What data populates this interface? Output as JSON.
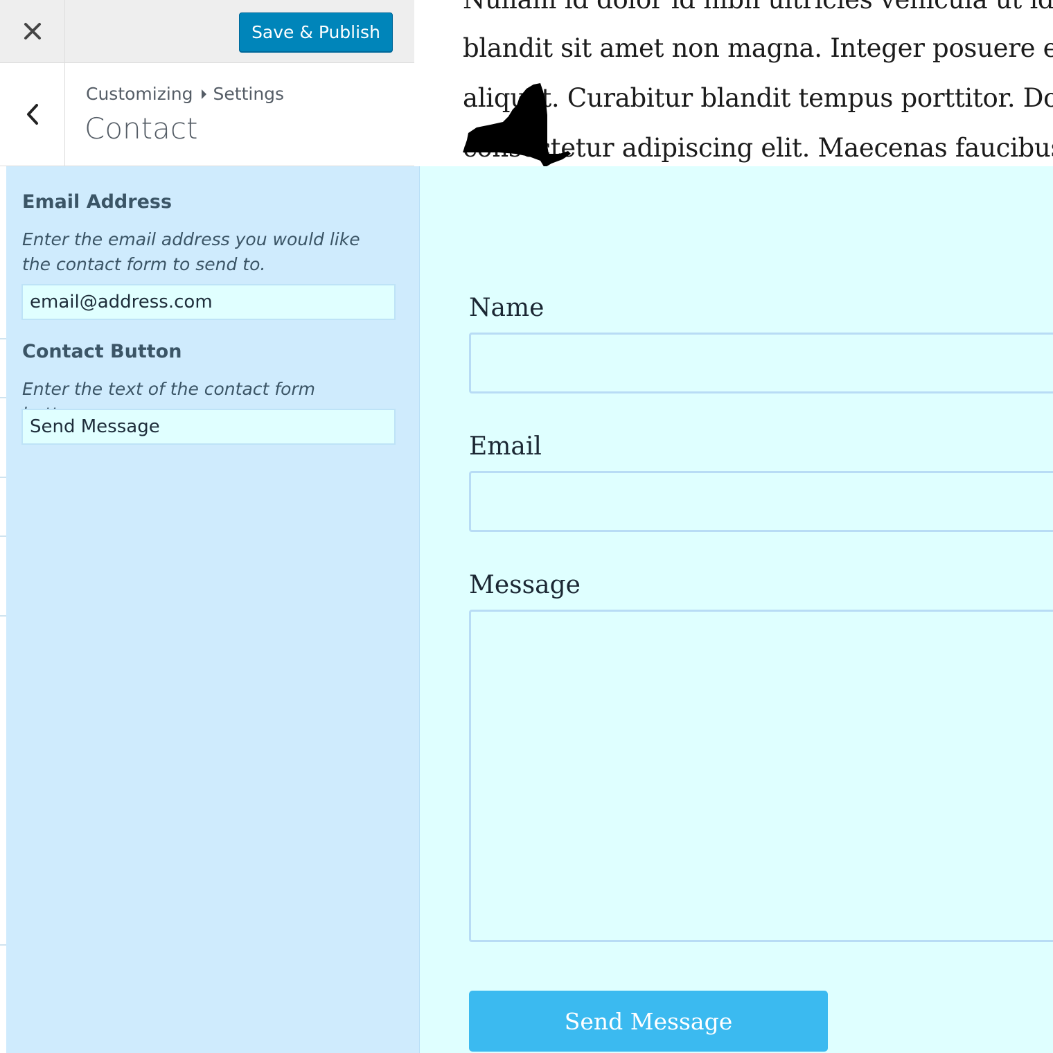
{
  "header": {
    "close_label": "close",
    "publish_label": "Save & Publish",
    "back_label": "back"
  },
  "section": {
    "breadcrumb": [
      "Customizing",
      "Settings"
    ],
    "title": "Contact"
  },
  "controls": {
    "email": {
      "label": "Email Address",
      "description": "Enter the email address you would like the contact form to send to.",
      "value": "email@address.com"
    },
    "button": {
      "label": "Contact Button",
      "description": "Enter the text of the contact form button.",
      "value": "Send Message"
    }
  },
  "preview": {
    "paragraph_lines": [
      "Nullam id dolor id nibh ultricies vehicula ut id elit.",
      "blandit sit amet non magna. Integer posuere erat a",
      "aliquet. Curabitur blandit tempus porttitor. Donec",
      "consectetur adipiscing elit. Maecenas faucibus mo"
    ],
    "form": {
      "name_label": "Name",
      "email_label": "Email",
      "message_label": "Message",
      "submit_label": "Send Message"
    }
  },
  "colors": {
    "primary_button": "#0085ba",
    "panel_background": "#cfebfd",
    "preview_background": "#dfffff",
    "send_button": "#3bbaf0"
  },
  "icons": {
    "close": "close-icon",
    "back": "chevron-left-icon",
    "map_shape": "new-york-state-icon"
  }
}
